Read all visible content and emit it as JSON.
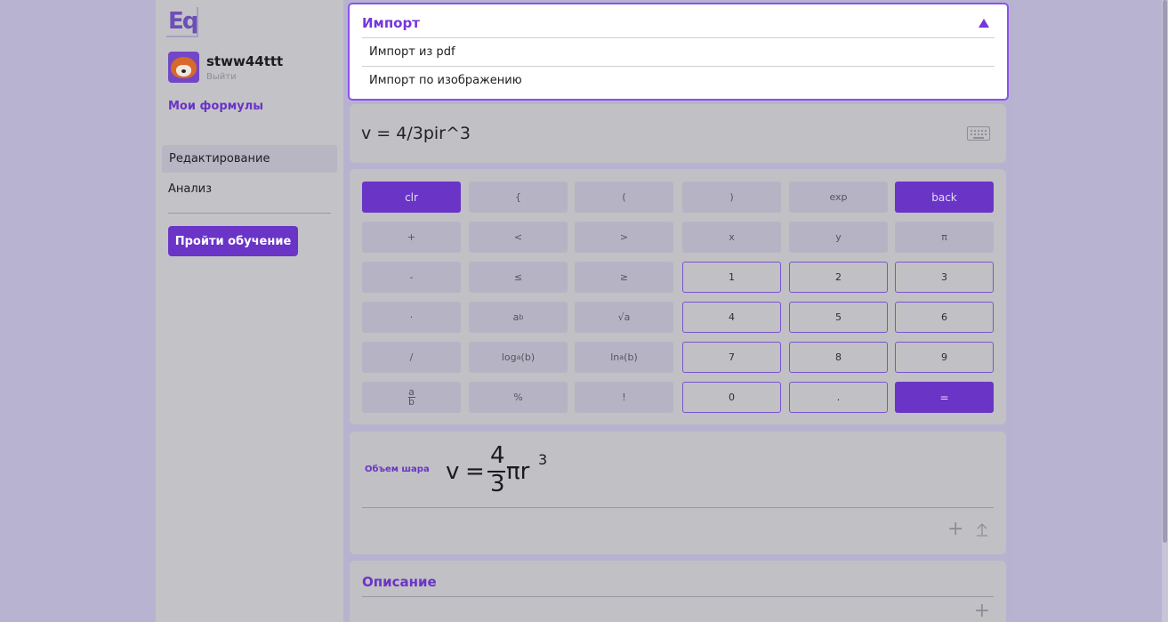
{
  "sidebar": {
    "logo": "Eq",
    "username": "stww44ttt",
    "logout": "Выйти",
    "my_formulas": "Мои формулы",
    "nav": {
      "edit": "Редактирование",
      "analysis": "Анализ"
    },
    "learn_button": "Пройти обучение"
  },
  "import": {
    "title": "Импорт",
    "options": [
      "Импорт из pdf",
      "Импорт по изображению"
    ]
  },
  "input": {
    "formula": "v = 4/3pir^3"
  },
  "keys": [
    [
      "clr",
      "{",
      "(",
      ")",
      "exp",
      "back"
    ],
    [
      "+",
      "<",
      ">",
      "x",
      "y",
      "π"
    ],
    [
      "-",
      "≤",
      "≥",
      "1",
      "2",
      "3"
    ],
    [
      "·",
      "a^b",
      "√a",
      "4",
      "5",
      "6"
    ],
    [
      "/",
      "log_a(b)",
      "ln_a(b)",
      "7",
      "8",
      "9"
    ],
    [
      "a/b",
      "%",
      "!",
      "0",
      ".",
      "="
    ]
  ],
  "result": {
    "label": "Объем шара",
    "v": "v",
    "eq": "=",
    "num": "4",
    "den": "3",
    "pir": "πr",
    "exp": "3"
  },
  "description": {
    "title": "Описание"
  },
  "colors": {
    "accent": "#6a34c7",
    "import_border": "#8a52f0"
  }
}
